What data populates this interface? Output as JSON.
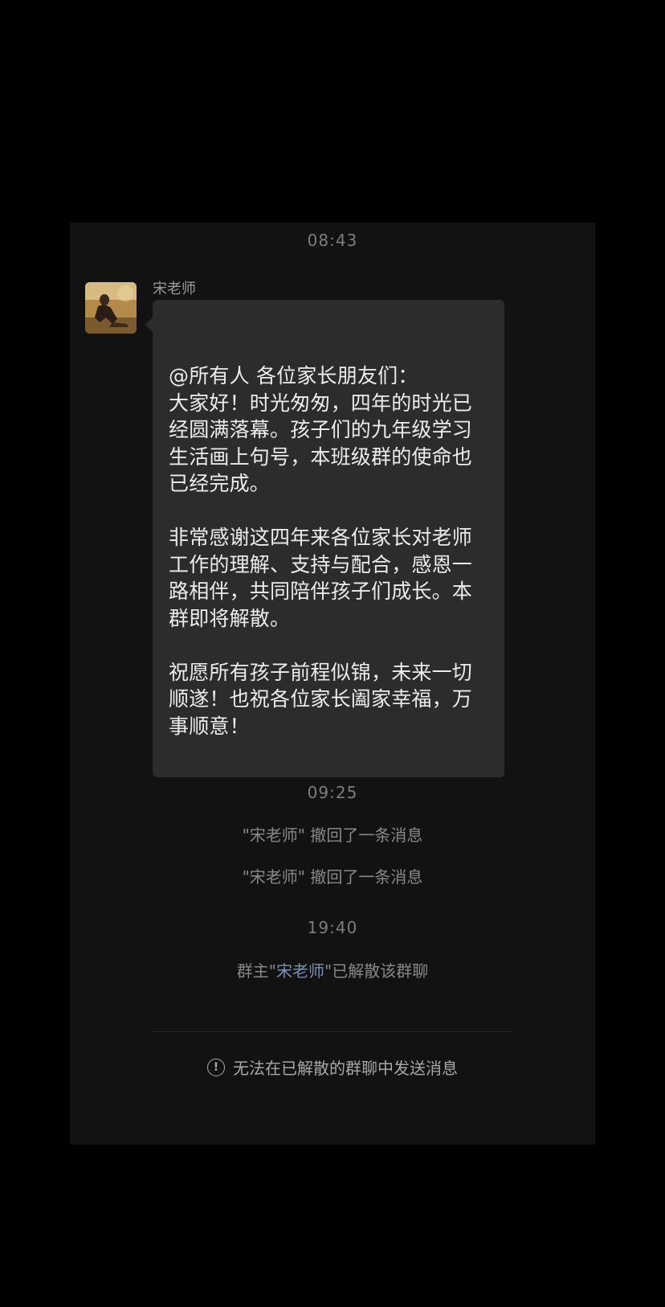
{
  "chat": {
    "timestamp_1": "08:43",
    "sender": {
      "name": "宋老师",
      "avatar_icon": "avatar-photo"
    },
    "message": {
      "paragraphs": [
        "@所有人 各位家长朋友们：\n大家好！时光匆匆，四年的时光已经圆满落幕。孩子们的九年级学习生活画上句号，本班级群的使命也已经完成。",
        "非常感谢这四年来各位家长对老师工作的理解、支持与配合，感恩一路相伴，共同陪伴孩子们成长。本群即将解散。",
        "祝愿所有孩子前程似锦，未来一切顺遂！也祝各位家长阖家幸福，万事顺意！"
      ]
    },
    "timestamp_2": "09:25",
    "recall_1": "\"宋老师\" 撤回了一条消息",
    "recall_2": "\"宋老师\" 撤回了一条消息",
    "timestamp_3": "19:40",
    "dissolve": {
      "prefix": "群主\"",
      "name": "宋老师",
      "suffix": "\"已解散该群聊"
    },
    "notice": {
      "icon": "info-icon",
      "text": "无法在已解散的群聊中发送消息"
    }
  },
  "colors": {
    "background": "#000000",
    "panel": "#121212",
    "bubble": "#2c2c2c",
    "link_name": "#7b8fb8"
  }
}
